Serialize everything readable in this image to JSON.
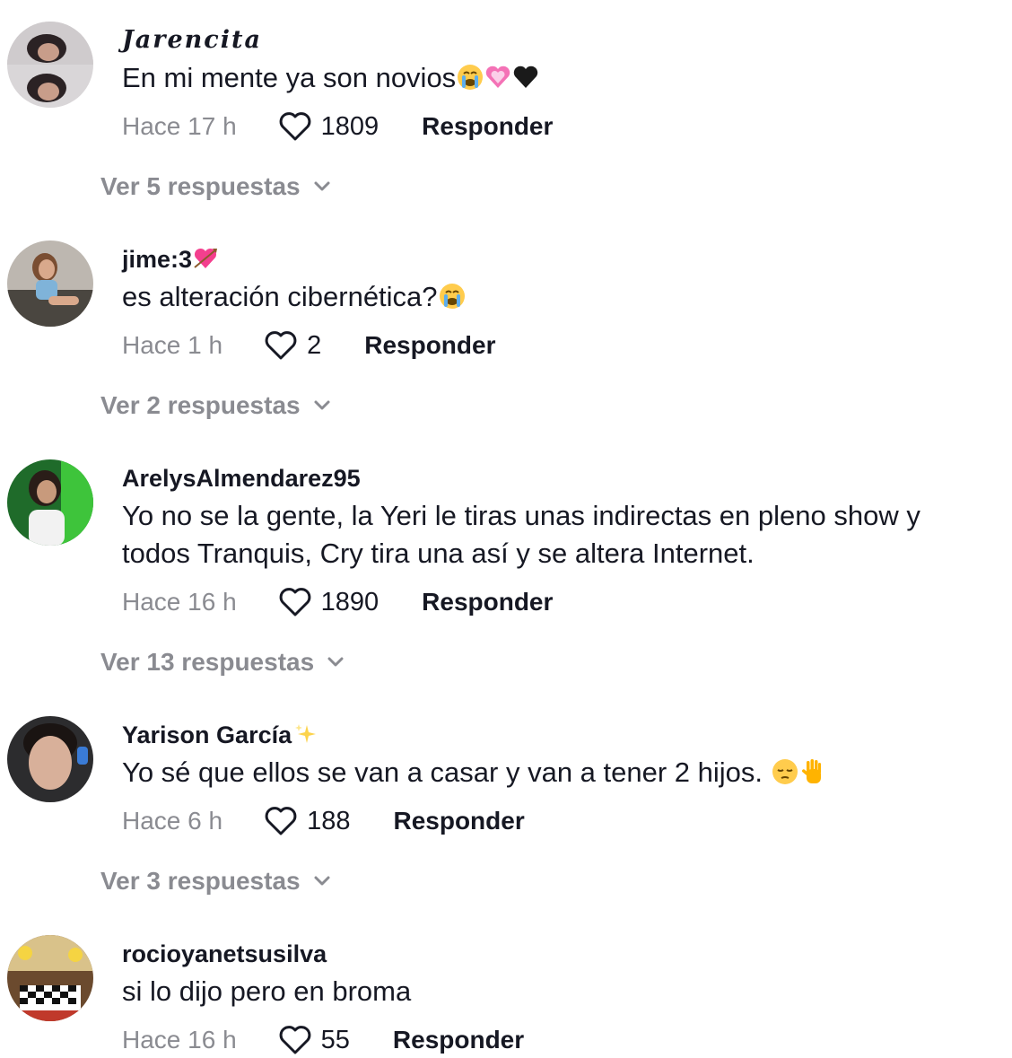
{
  "comments": [
    {
      "username": "Jarencita",
      "text": "En mi mente ya son novios",
      "emojis": [
        "crying-face",
        "pink-heart",
        "black-heart"
      ],
      "time": "Hace 17 h",
      "likes": "1809",
      "reply_label": "Responder",
      "view_replies": "Ver 5 respuestas"
    },
    {
      "username": "jime:3",
      "username_emoji": "heart-arrow",
      "text": "es alteración cibernética?",
      "emojis": [
        "crying-face"
      ],
      "time": "Hace 1 h",
      "likes": "2",
      "reply_label": "Responder",
      "view_replies": "Ver 2 respuestas"
    },
    {
      "username": "ArelysAlmendarez95",
      "text": "Yo no se la gente, la Yeri le tiras unas indirectas en pleno show y todos Tranquis, Cry tira una así y se altera Internet.",
      "time": "Hace 16 h",
      "likes": "1890",
      "reply_label": "Responder",
      "view_replies": "Ver 13 respuestas"
    },
    {
      "username": "Yarison García",
      "username_emoji": "sparkles",
      "text": "Yo sé que ellos se van a casar y van a tener 2 hijos. ",
      "emojis": [
        "pensive-face",
        "raised-hand"
      ],
      "time": "Hace 6 h",
      "likes": "188",
      "reply_label": "Responder",
      "view_replies": "Ver 3 respuestas"
    },
    {
      "username": "rocioyanetsusilva",
      "text": "si lo dijo pero en broma",
      "time": "Hace 16 h",
      "likes": "55",
      "reply_label": "Responder"
    }
  ],
  "colors": {
    "primary_text": "#161823",
    "secondary_text": "#8a8b91"
  }
}
